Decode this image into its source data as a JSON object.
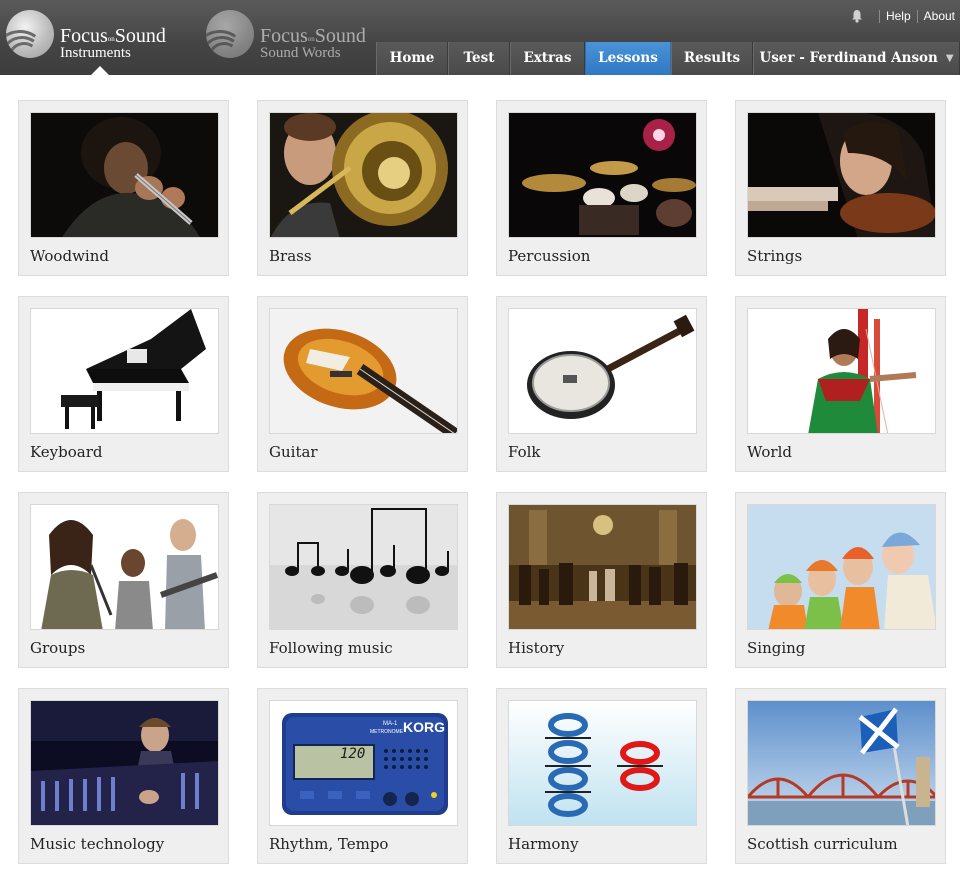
{
  "header": {
    "brands": [
      {
        "name_first": "Focus",
        "name_on": "on",
        "name_last": "Sound",
        "subtitle": "Instruments",
        "active": true
      },
      {
        "name_first": "Focus",
        "name_on": "on",
        "name_last": "Sound",
        "subtitle": "Sound Words",
        "active": false
      }
    ],
    "utility": {
      "bell_icon": "bell-icon",
      "help_label": "Help",
      "about_label": "About"
    },
    "nav": [
      {
        "label": "Home",
        "active": false
      },
      {
        "label": "Test",
        "active": false
      },
      {
        "label": "Extras",
        "active": false
      },
      {
        "label": "Lessons",
        "active": true
      },
      {
        "label": "Results",
        "active": false
      },
      {
        "label": "User - Ferdinand Anson",
        "active": false,
        "dropdown": true
      }
    ]
  },
  "colors": {
    "header_bg": "#444444",
    "active_tab": "#3a86cf",
    "tile_bg": "#efefef",
    "label_text": "#222222"
  },
  "lessons": [
    {
      "label": "Woodwind",
      "image": "flute-player-photo"
    },
    {
      "label": "Brass",
      "image": "trombone-player-photo"
    },
    {
      "label": "Percussion",
      "image": "drum-kit-photo"
    },
    {
      "label": "Strings",
      "image": "violinist-photo"
    },
    {
      "label": "Keyboard",
      "image": "grand-piano-photo"
    },
    {
      "label": "Guitar",
      "image": "electric-guitar-photo"
    },
    {
      "label": "Folk",
      "image": "banjo-photo"
    },
    {
      "label": "World",
      "image": "harp-singer-photo"
    },
    {
      "label": "Groups",
      "image": "band-photo"
    },
    {
      "label": "Following music",
      "image": "music-notes-photo"
    },
    {
      "label": "History",
      "image": "baroque-painting-photo"
    },
    {
      "label": "Singing",
      "image": "carol-singers-photo"
    },
    {
      "label": "Music technology",
      "image": "mixing-desk-photo"
    },
    {
      "label": "Rhythm, Tempo",
      "image": "metronome-photo",
      "device_brand": "KORG",
      "device_model": "MA-1",
      "device_name": "METRONOME",
      "display_value": "120"
    },
    {
      "label": "Harmony",
      "image": "harmony-notes-photo"
    },
    {
      "label": "Scottish curriculum",
      "image": "forth-bridge-photo"
    }
  ]
}
